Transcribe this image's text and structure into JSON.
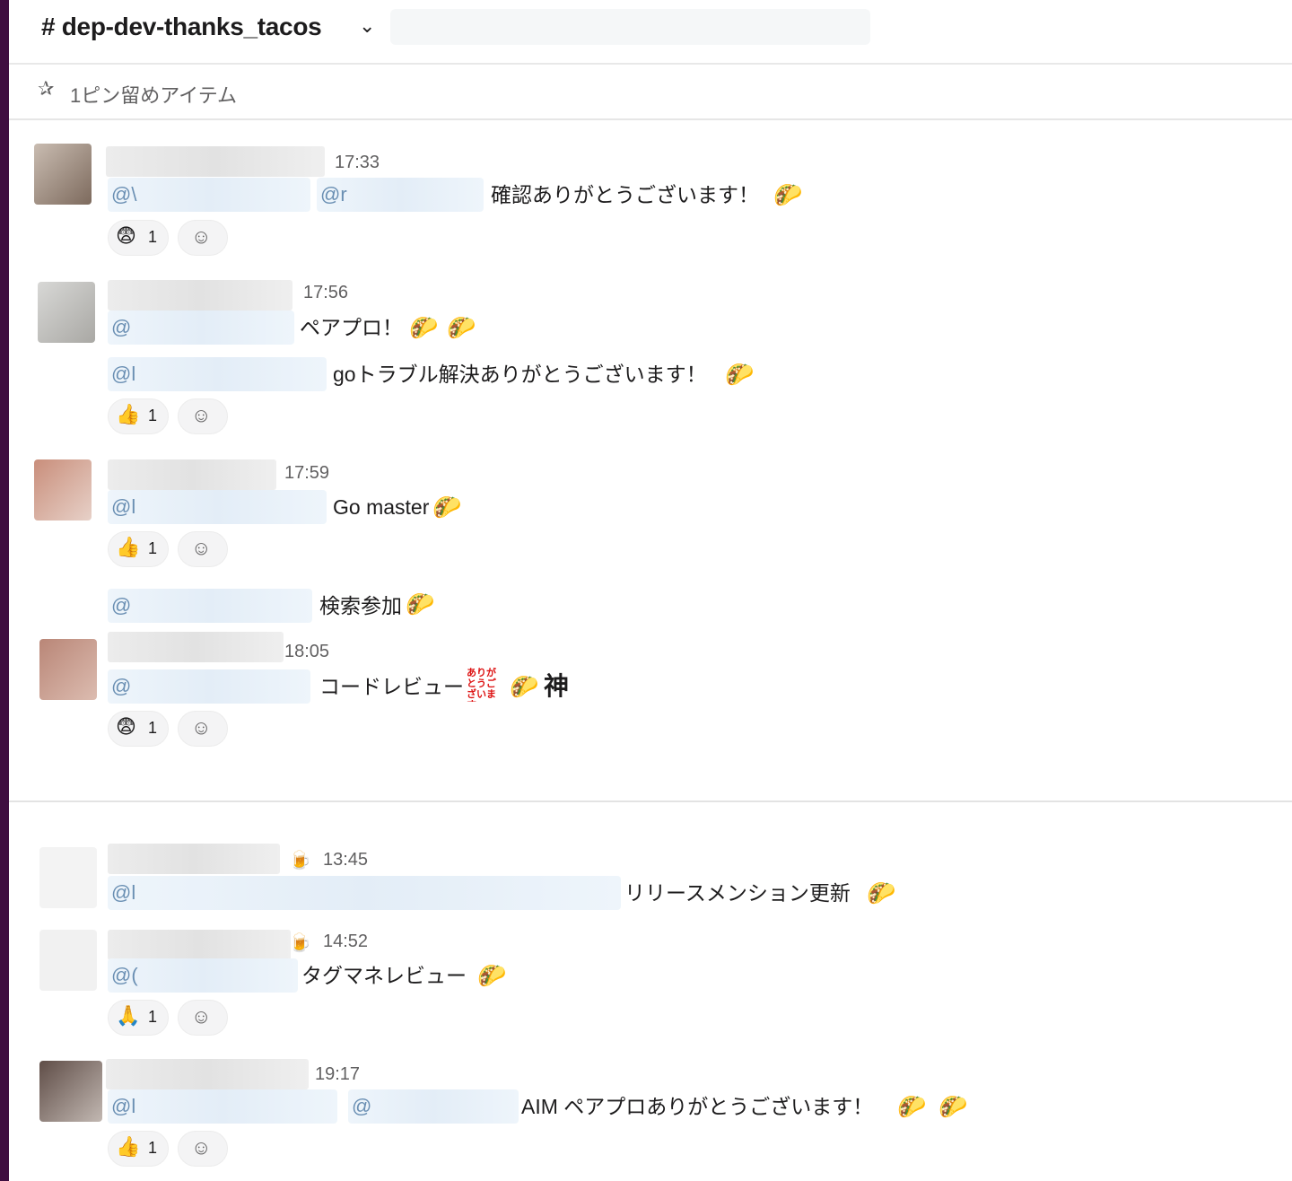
{
  "header": {
    "channel": "# dep-dev-thanks_tacos",
    "chevron": "⌄"
  },
  "pinbar": {
    "label": "1ピン留めアイテム"
  },
  "messages": [
    {
      "time": "17:33",
      "mentions": [
        "@\\",
        "@r"
      ],
      "text": "確認ありがとうございます！",
      "reaction": {
        "emoji": "😨",
        "count": "1"
      }
    },
    {
      "time": "17:56",
      "mentions": [
        "@"
      ],
      "text": "ペアプロ！"
    },
    {
      "mentions": [
        "@l"
      ],
      "text": "goトラブル解決ありがとうございます！",
      "reaction": {
        "emoji": "👍",
        "count": "1"
      }
    },
    {
      "time": "17:59",
      "mentions": [
        "@l"
      ],
      "text": "Go master",
      "reaction": {
        "emoji": "👍",
        "count": "1"
      }
    },
    {
      "mentions": [
        "@"
      ],
      "text": "検索参加"
    },
    {
      "time": "18:05",
      "mentions": [
        "@"
      ],
      "text": "コードレビュー",
      "stamp": "ありがとうございます",
      "extra": "神",
      "reaction": {
        "emoji": "😨",
        "count": "1"
      }
    },
    {
      "time": "13:45",
      "mentions": [
        "@l"
      ],
      "text": "リリースメンション更新"
    },
    {
      "time": "14:52",
      "mentions": [
        "@("
      ],
      "text": "タグマネレビュー",
      "reaction": {
        "emoji": "🙏",
        "count": "1"
      }
    },
    {
      "time": "19:17",
      "mentions": [
        "@l",
        "@"
      ],
      "text": "AIM ペアプロありがとうございます！",
      "reaction": {
        "emoji": "👍",
        "count": "1"
      }
    }
  ],
  "icons": {
    "taco": "🌮",
    "beer": "🍺",
    "add_reaction": "☺",
    "pin": "✰"
  }
}
